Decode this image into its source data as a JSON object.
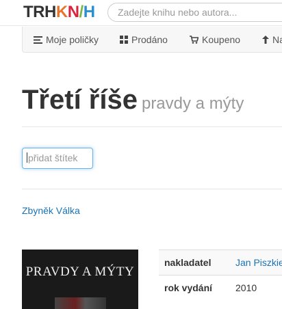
{
  "header": {
    "logo": [
      "T",
      "R",
      "H",
      "K",
      "N",
      "/",
      "H"
    ],
    "logo_colors": [
      "#222222",
      "#222222",
      "#222222",
      "#e8742a",
      "#d9243d",
      "#7ab648",
      "#2a8fd0"
    ],
    "search_placeholder": "Zadejte knihu nebo autora..."
  },
  "nav": {
    "items": [
      {
        "label": "Moje poličky",
        "icon": "list-icon"
      },
      {
        "label": "Prodáno",
        "icon": "grid-icon"
      },
      {
        "label": "Koupeno",
        "icon": "cart-icon"
      },
      {
        "label": "Na",
        "icon": "arrow-up-icon"
      }
    ]
  },
  "book": {
    "title": "Třetí říše",
    "subtitle": "pravdy a mýty",
    "tag_placeholder": "přidat štítek",
    "author": "Zbyněk Válka",
    "cover_title": "PRAVDY A MÝTY",
    "details": [
      {
        "key": "nakladatel",
        "value": "Jan Piszkie",
        "link": true
      },
      {
        "key": "rok vydání",
        "value": "2010",
        "link": false
      }
    ]
  }
}
